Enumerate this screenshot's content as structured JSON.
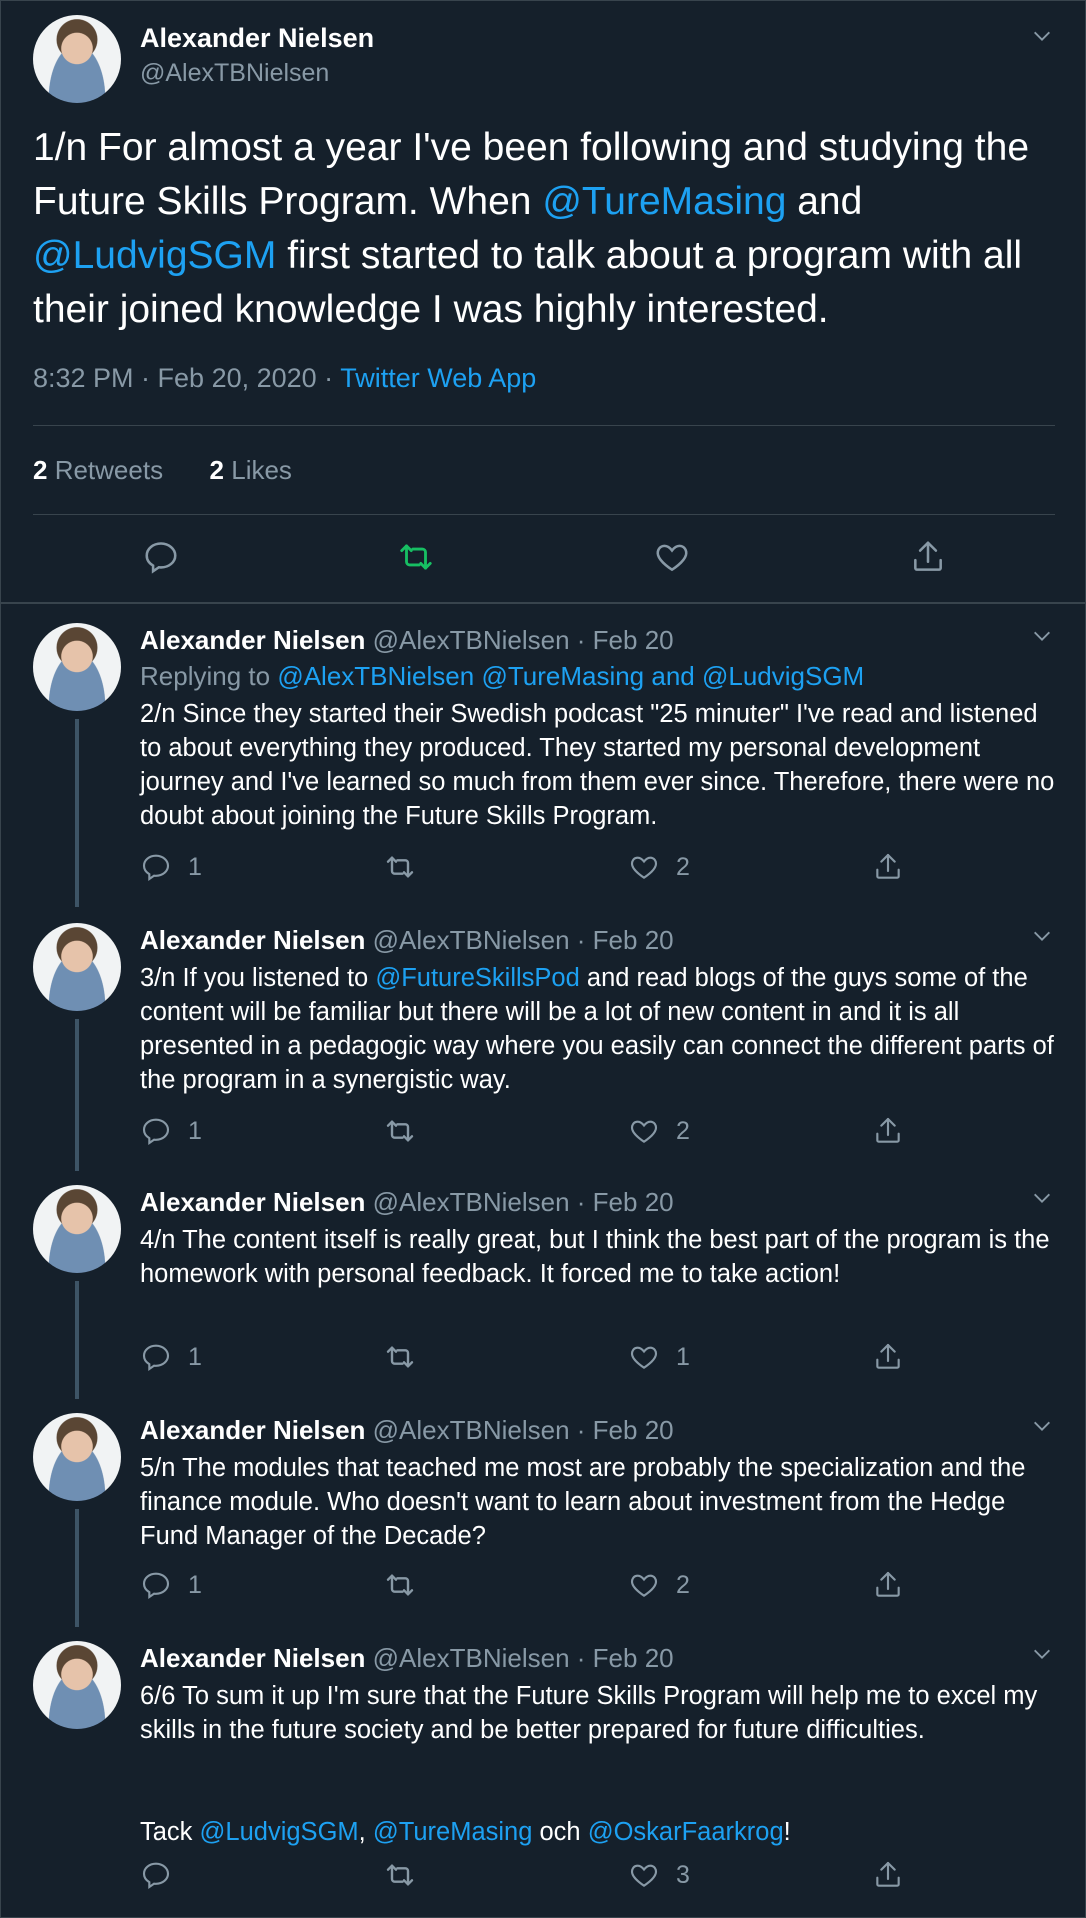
{
  "main": {
    "name": "Alexander Nielsen",
    "handle": "@AlexTBNielsen",
    "text_parts": [
      "1/n For almost a year I've been following and studying the Future Skills Program. When ",
      "@TureMasing",
      " and ",
      "@LudvigSGM",
      " first started to talk about a program with all their joined knowledge I was highly interested."
    ],
    "time_date": "8:32 PM · Feb 20, 2020 · ",
    "source": "Twitter Web App",
    "retweets_count": "2",
    "retweets_label": " Retweets",
    "likes_count": "2",
    "likes_label": " Likes"
  },
  "replies": [
    {
      "name": "Alexander Nielsen",
      "handle_date": " @AlexTBNielsen · Feb 20",
      "replying_prefix": "Replying to ",
      "replying_links": "@AlexTBNielsen @TureMasing and @LudvigSGM",
      "text": "2/n Since they started their Swedish podcast \"25 minuter\" I've read and listened to about everything they produced. They started my personal development journey and I've learned so much from them ever since. Therefore, there were no doubt about joining the Future Skills Program.",
      "replies": "1",
      "likes": "2"
    },
    {
      "name": "Alexander Nielsen",
      "handle_date": " @AlexTBNielsen · Feb 20",
      "text_a": "3/n If you listened to ",
      "text_link": "@FutureSkillsPod",
      "text_b": " and read blogs of the guys some of the content will be familiar but there will be a lot of new content in and it is all presented in a pedagogic way where you easily can connect the different parts of the program in a synergistic way.",
      "replies": "1",
      "likes": "2"
    },
    {
      "name": "Alexander Nielsen",
      "handle_date": " @AlexTBNielsen · Feb 20",
      "text": "4/n The content itself is really great, but I think the best part of the program is the homework with personal feedback. It forced me to take action!",
      "replies": "1",
      "likes": "1"
    },
    {
      "name": "Alexander Nielsen",
      "handle_date": " @AlexTBNielsen · Feb 20",
      "text": "5/n The modules that teached me most are probably the specialization and the finance module. Who doesn't want to learn about investment from the Hedge Fund Manager of the Decade?",
      "replies": "1",
      "likes": "2"
    },
    {
      "name": "Alexander Nielsen",
      "handle_date": " @AlexTBNielsen · Feb 20",
      "text": "6/6 To sum it up I'm sure that the Future Skills Program will help me to excel my skills in the future society and be better prepared for future difficulties.",
      "tack_prefix": "Tack ",
      "tack_link1": "@LudvigSGM",
      "tack_sep": ", ",
      "tack_link2": "@TureMasing",
      "tack_mid": " och ",
      "tack_link3": "@OskarFaarkrog",
      "tack_end": "!",
      "replies": "",
      "likes": "3"
    }
  ],
  "colors": {
    "background": "#15202b",
    "accent": "#1da1f2",
    "retweet_active": "#17bf63",
    "muted": "#8899a6"
  },
  "icons": [
    "chevron-down-icon",
    "reply-icon",
    "retweet-icon",
    "like-icon",
    "share-icon"
  ]
}
